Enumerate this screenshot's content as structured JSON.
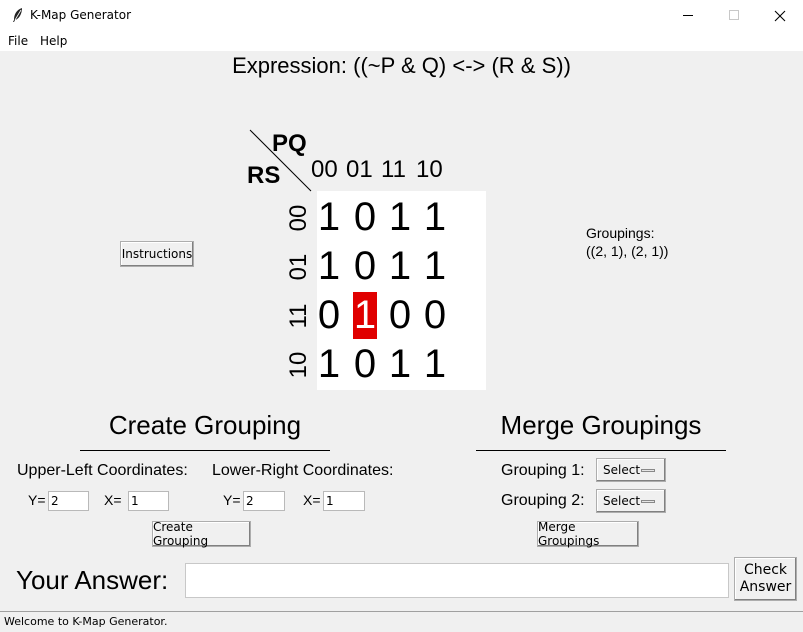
{
  "window": {
    "title": "K-Map Generator"
  },
  "menu": [
    {
      "label": "File"
    },
    {
      "label": "Help"
    }
  ],
  "expression": {
    "label": "Expression: ((~P & Q) <-> (R & S))"
  },
  "kmap": {
    "col_var": "PQ",
    "row_var": "RS",
    "col_headers": [
      "00",
      "01",
      "11",
      "10"
    ],
    "row_headers": [
      "00",
      "01",
      "11",
      "10"
    ],
    "cells": [
      [
        "1",
        "0",
        "1",
        "1"
      ],
      [
        "1",
        "0",
        "1",
        "1"
      ],
      [
        "0",
        "1",
        "0",
        "0"
      ],
      [
        "1",
        "0",
        "1",
        "1"
      ]
    ],
    "highlighted_cell": {
      "row": 2,
      "col": 1
    },
    "highlight_color": "#e00000"
  },
  "instructions_button": {
    "label": "Instructions"
  },
  "groupings": {
    "label": "Groupings:",
    "value": "((2, 1), (2, 1))"
  },
  "create_grouping": {
    "title": "Create Grouping",
    "upper_left_label": "Upper-Left Coordinates:",
    "lower_right_label": "Lower-Right Coordinates:",
    "y_label": "Y=",
    "x_label": "X=",
    "ul_y": "2",
    "ul_x": "1",
    "lr_y": "2",
    "lr_x": "1",
    "button_label": "Create Grouping"
  },
  "merge_groupings": {
    "title": "Merge Groupings",
    "grouping1_label": "Grouping 1:",
    "grouping2_label": "Grouping 2:",
    "grouping1_value": "Select",
    "grouping2_value": "Select",
    "button_label": "Merge Groupings"
  },
  "answer": {
    "label": "Your Answer:",
    "value": "",
    "check_button_line1": "Check",
    "check_button_line2": "Answer"
  },
  "status": {
    "text": "Welcome to K-Map Generator."
  }
}
